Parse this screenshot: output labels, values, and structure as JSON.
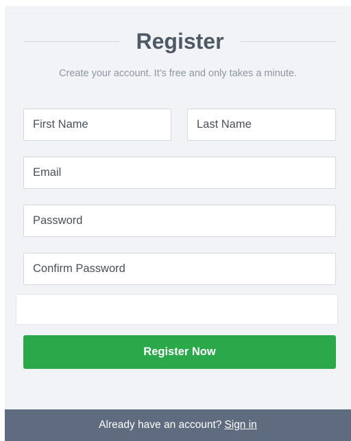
{
  "form": {
    "title": "Register",
    "subtitle": "Create your account. It's free and only takes a minute.",
    "fields": {
      "first_name_placeholder": "First Name",
      "last_name_placeholder": "Last Name",
      "email_placeholder": "Email",
      "password_placeholder": "Password",
      "confirm_password_placeholder": "Confirm Password"
    },
    "submit_label": "Register Now"
  },
  "footer": {
    "prompt": "Already have an account?",
    "link_label": "Sign in"
  },
  "colors": {
    "card_background": "#f2f3f7",
    "button_green": "#2aa84a",
    "footer_background": "#5f6c80",
    "title_text": "#4f5a66"
  }
}
